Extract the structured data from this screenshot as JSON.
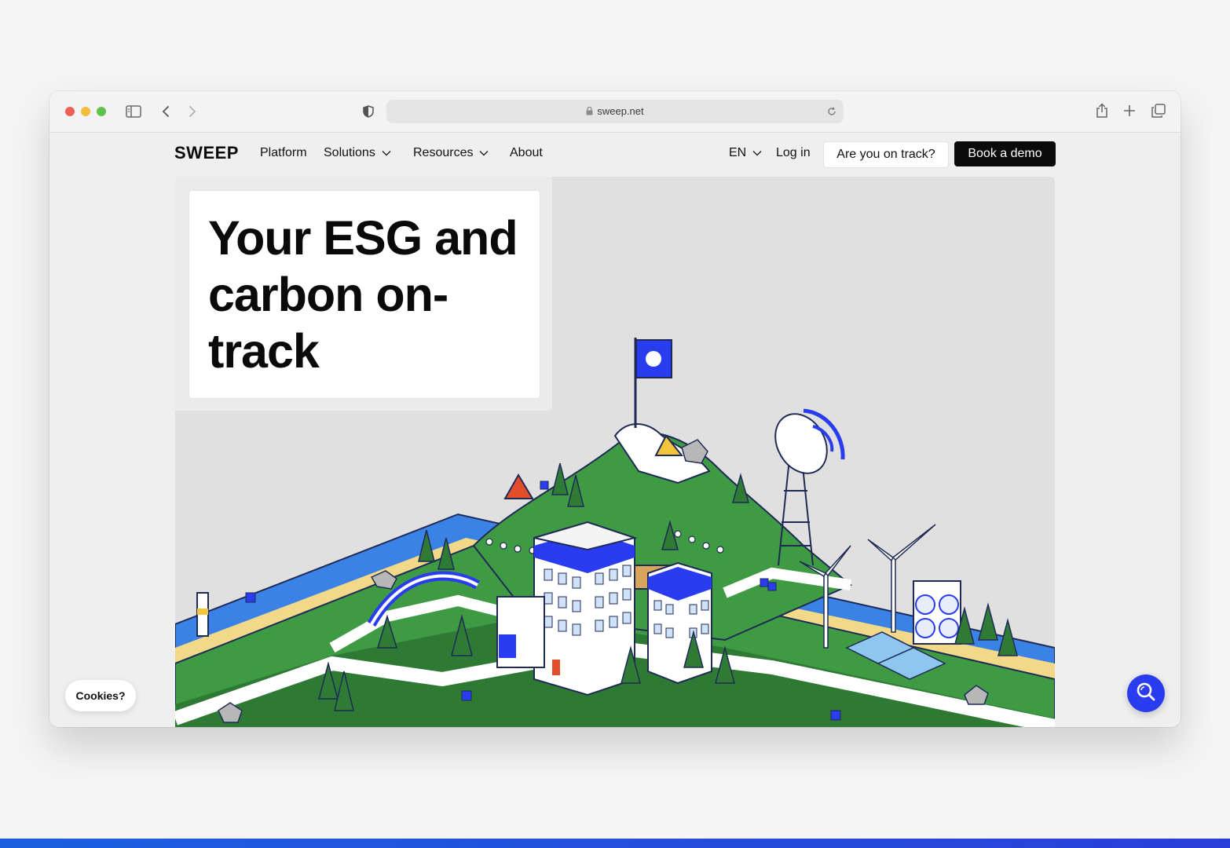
{
  "browser": {
    "url": "sweep.net",
    "icons": [
      "sidebar-icon",
      "back-icon",
      "forward-icon",
      "shield-icon",
      "lock-icon",
      "reload-icon",
      "share-icon",
      "new-tab-icon",
      "tabs-icon"
    ]
  },
  "nav": {
    "logo": "SWEEP",
    "items": [
      {
        "label": "Platform"
      },
      {
        "label": "Solutions"
      },
      {
        "label": "Resources"
      },
      {
        "label": "About"
      }
    ],
    "language": "EN",
    "login": "Log in",
    "track_button": "Are you on track?",
    "demo_button": "Book a demo"
  },
  "hero": {
    "title": "Your ESG and carbon on-track"
  },
  "cookies": "Cookies?",
  "colors": {
    "accent": "#2a3cf0",
    "grass": "#3f9a44",
    "water": "#3b82e6",
    "sand": "#f2d98a"
  }
}
